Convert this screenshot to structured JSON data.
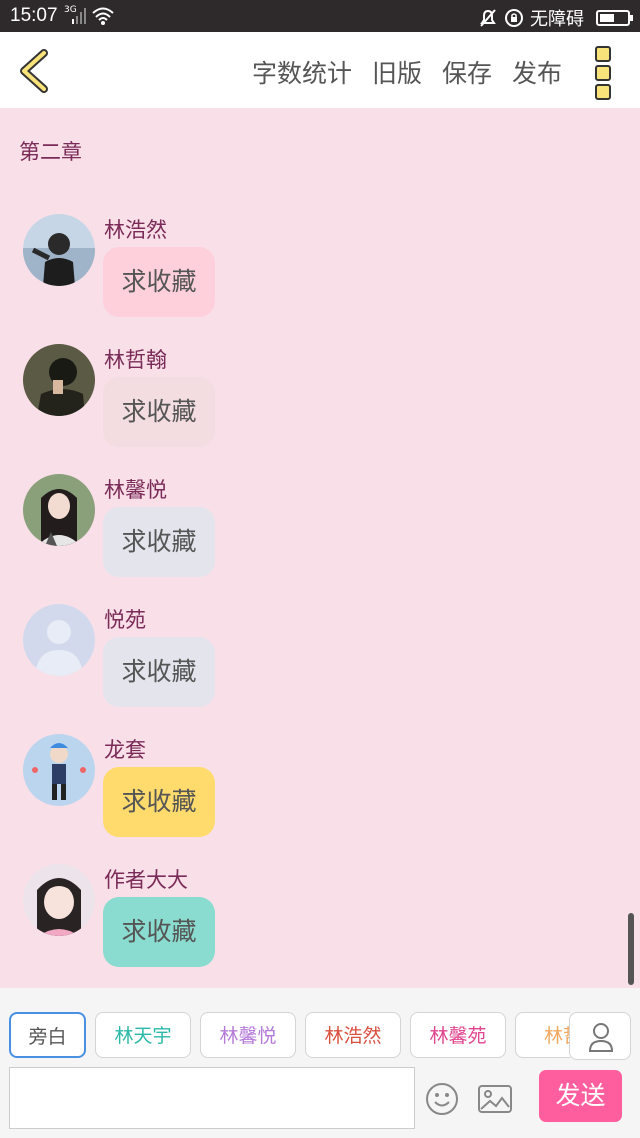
{
  "status_bar": {
    "time": "15:07",
    "network": "3G",
    "accessibility": "无障碍"
  },
  "toolbar": {
    "word_count": "字数统计",
    "old_version": "旧版",
    "save": "保存",
    "publish": "发布"
  },
  "chapter": {
    "title": "第二章"
  },
  "messages": [
    {
      "name": "林浩然",
      "text": "求收藏",
      "bubble_color": "#fdd0dc"
    },
    {
      "name": "林哲翰",
      "text": "求收藏",
      "bubble_color": "#f3dde0"
    },
    {
      "name": "林馨悦",
      "text": "求收藏",
      "bubble_color": "#e3e4ec"
    },
    {
      "name": "悦苑",
      "text": "求收藏",
      "bubble_color": "#e3e4ec"
    },
    {
      "name": "龙套",
      "text": "求收藏",
      "bubble_color": "#fedb6c"
    },
    {
      "name": "作者大大",
      "text": "求收藏",
      "bubble_color": "#89dccf"
    }
  ],
  "characters": [
    {
      "label": "旁白",
      "color": "#555555",
      "selected": true
    },
    {
      "label": "林天宇",
      "color": "#2ab8a8"
    },
    {
      "label": "林馨悦",
      "color": "#b57bd8"
    },
    {
      "label": "林浩然",
      "color": "#d9503f"
    },
    {
      "label": "林馨苑",
      "color": "#e0468e"
    },
    {
      "label": "林哲",
      "color": "#f0a860"
    }
  ],
  "composer": {
    "input_value": "",
    "send_label": "发送"
  },
  "colors": {
    "background": "#f9dfe8",
    "accent": "#ff5e9e",
    "name_color": "#7a2b57"
  }
}
